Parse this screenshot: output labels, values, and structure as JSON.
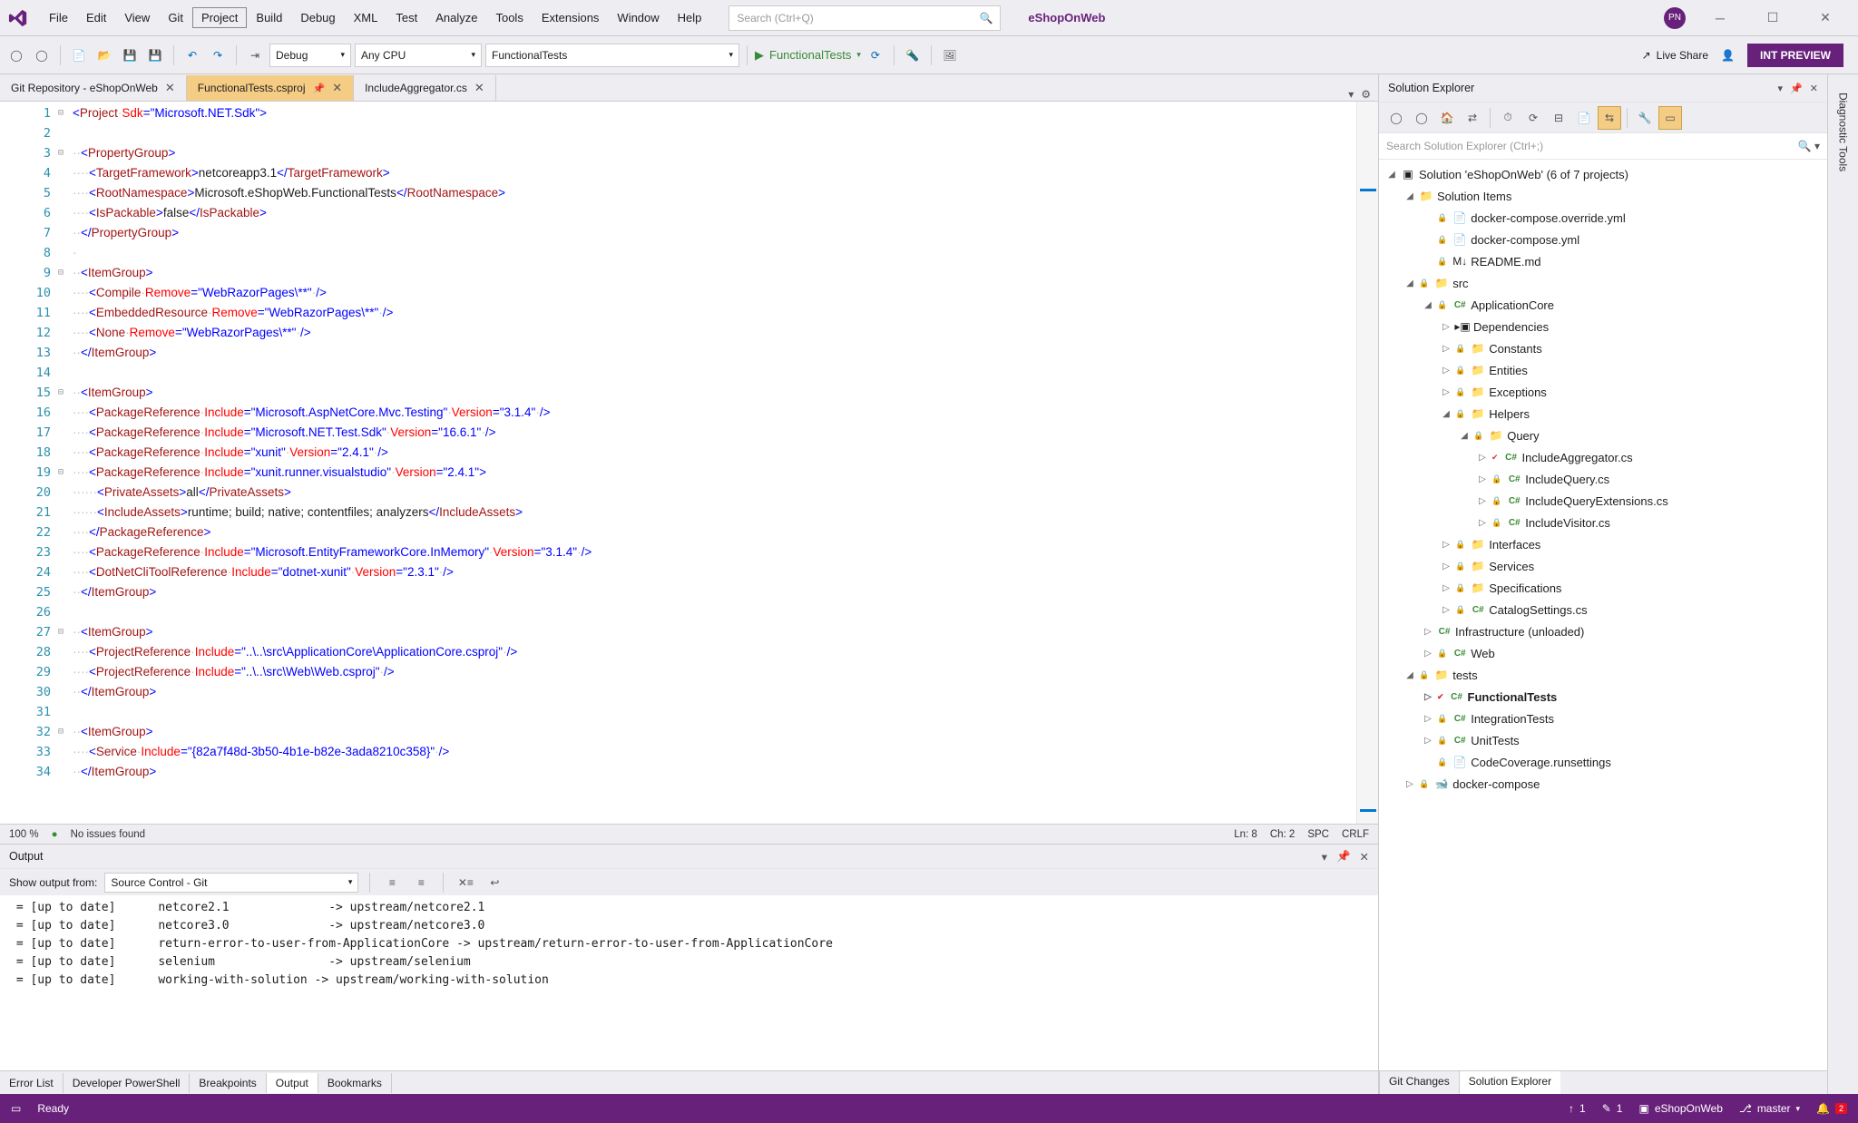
{
  "menubar": {
    "items": [
      "File",
      "Edit",
      "View",
      "Git",
      "Project",
      "Build",
      "Debug",
      "XML",
      "Test",
      "Analyze",
      "Tools",
      "Extensions",
      "Window",
      "Help"
    ],
    "boxedIndex": 4,
    "searchPlaceholder": "Search (Ctrl+Q)",
    "solutionName": "eShopOnWeb",
    "avatar": "PN"
  },
  "toolbar": {
    "config": "Debug",
    "platform": "Any CPU",
    "startupProject": "FunctionalTests",
    "startTarget": "FunctionalTests",
    "liveShare": "Live Share",
    "intPreview": "INT PREVIEW"
  },
  "tabs": {
    "items": [
      {
        "label": "Git Repository - eShopOnWeb",
        "active": false,
        "pinned": false
      },
      {
        "label": "FunctionalTests.csproj",
        "active": true,
        "pinned": true
      },
      {
        "label": "IncludeAggregator.cs",
        "active": false,
        "pinned": false
      }
    ]
  },
  "editor": {
    "lines": [
      {
        "n": 1,
        "fold": "⊟",
        "html": "<span class='c-blue'>&lt;</span><span class='c-brown'>Project</span><span class='c-dot'>·</span><span class='c-red'>Sdk</span><span class='c-blue'>=\"Microsoft.NET.Sdk\"&gt;</span>"
      },
      {
        "n": 2,
        "fold": "",
        "html": ""
      },
      {
        "n": 3,
        "fold": "⊟",
        "html": "<span class='c-dot'>··</span><span class='c-blue'>&lt;</span><span class='c-brown'>PropertyGroup</span><span class='c-blue'>&gt;</span>"
      },
      {
        "n": 4,
        "fold": "",
        "html": "<span class='c-dot'>····</span><span class='c-blue'>&lt;</span><span class='c-brown'>TargetFramework</span><span class='c-blue'>&gt;</span>netcoreapp3.1<span class='c-blue'>&lt;/</span><span class='c-brown'>TargetFramework</span><span class='c-blue'>&gt;</span>"
      },
      {
        "n": 5,
        "fold": "",
        "html": "<span class='c-dot'>····</span><span class='c-blue'>&lt;</span><span class='c-brown'>RootNamespace</span><span class='c-blue'>&gt;</span>Microsoft.eShopWeb.FunctionalTests<span class='c-blue'>&lt;/</span><span class='c-brown'>RootNamespace</span><span class='c-blue'>&gt;</span>"
      },
      {
        "n": 6,
        "fold": "",
        "html": "<span class='c-dot'>····</span><span class='c-blue'>&lt;</span><span class='c-brown'>IsPackable</span><span class='c-blue'>&gt;</span>false<span class='c-blue'>&lt;/</span><span class='c-brown'>IsPackable</span><span class='c-blue'>&gt;</span>"
      },
      {
        "n": 7,
        "fold": "",
        "html": "<span class='c-dot'>··</span><span class='c-blue'>&lt;/</span><span class='c-brown'>PropertyGroup</span><span class='c-blue'>&gt;</span>"
      },
      {
        "n": 8,
        "fold": "",
        "html": "<span class='c-dot'>·</span>"
      },
      {
        "n": 9,
        "fold": "⊟",
        "html": "<span class='c-dot'>··</span><span class='c-blue'>&lt;</span><span class='c-brown'>ItemGroup</span><span class='c-blue'>&gt;</span>"
      },
      {
        "n": 10,
        "fold": "",
        "html": "<span class='c-dot'>····</span><span class='c-blue'>&lt;</span><span class='c-brown'>Compile</span><span class='c-dot'>·</span><span class='c-red'>Remove</span><span class='c-blue'>=\"WebRazorPages\\**\"</span><span class='c-dot'>·</span><span class='c-blue'>/&gt;</span>"
      },
      {
        "n": 11,
        "fold": "",
        "html": "<span class='c-dot'>····</span><span class='c-blue'>&lt;</span><span class='c-brown'>EmbeddedResource</span><span class='c-dot'>·</span><span class='c-red'>Remove</span><span class='c-blue'>=\"WebRazorPages\\**\"</span><span class='c-dot'>·</span><span class='c-blue'>/&gt;</span>"
      },
      {
        "n": 12,
        "fold": "",
        "html": "<span class='c-dot'>····</span><span class='c-blue'>&lt;</span><span class='c-brown'>None</span><span class='c-dot'>·</span><span class='c-red'>Remove</span><span class='c-blue'>=\"WebRazorPages\\**\"</span><span class='c-dot'>·</span><span class='c-blue'>/&gt;</span>"
      },
      {
        "n": 13,
        "fold": "",
        "html": "<span class='c-dot'>··</span><span class='c-blue'>&lt;/</span><span class='c-brown'>ItemGroup</span><span class='c-blue'>&gt;</span>"
      },
      {
        "n": 14,
        "fold": "",
        "html": ""
      },
      {
        "n": 15,
        "fold": "⊟",
        "html": "<span class='c-dot'>··</span><span class='c-blue'>&lt;</span><span class='c-brown'>ItemGroup</span><span class='c-blue'>&gt;</span>"
      },
      {
        "n": 16,
        "fold": "",
        "html": "<span class='c-dot'>····</span><span class='c-blue'>&lt;</span><span class='c-brown'>PackageReference</span><span class='c-dot'>·</span><span class='c-red'>Include</span><span class='c-blue'>=\"Microsoft.AspNetCore.Mvc.Testing\"</span><span class='c-dot'>·</span><span class='c-red'>Version</span><span class='c-blue'>=\"3.1.4\"</span><span class='c-dot'>·</span><span class='c-blue'>/&gt;</span>"
      },
      {
        "n": 17,
        "fold": "",
        "html": "<span class='c-dot'>····</span><span class='c-blue'>&lt;</span><span class='c-brown'>PackageReference</span><span class='c-dot'>·</span><span class='c-red'>Include</span><span class='c-blue'>=\"Microsoft.NET.Test.Sdk\"</span><span class='c-dot'>·</span><span class='c-red'>Version</span><span class='c-blue'>=\"16.6.1\"</span><span class='c-dot'>·</span><span class='c-blue'>/&gt;</span>"
      },
      {
        "n": 18,
        "fold": "",
        "html": "<span class='c-dot'>····</span><span class='c-blue'>&lt;</span><span class='c-brown'>PackageReference</span><span class='c-dot'>·</span><span class='c-red'>Include</span><span class='c-blue'>=\"xunit\"</span><span class='c-dot'>·</span><span class='c-red'>Version</span><span class='c-blue'>=\"2.4.1\"</span><span class='c-dot'>·</span><span class='c-blue'>/&gt;</span>"
      },
      {
        "n": 19,
        "fold": "⊟",
        "html": "<span class='c-dot'>····</span><span class='c-blue'>&lt;</span><span class='c-brown'>PackageReference</span><span class='c-dot'>·</span><span class='c-red'>Include</span><span class='c-blue'>=\"xunit.runner.visualstudio\"</span><span class='c-dot'>·</span><span class='c-red'>Version</span><span class='c-blue'>=\"2.4.1\"&gt;</span>"
      },
      {
        "n": 20,
        "fold": "",
        "html": "<span class='c-dot'>······</span><span class='c-blue'>&lt;</span><span class='c-brown'>PrivateAssets</span><span class='c-blue'>&gt;</span>all<span class='c-blue'>&lt;/</span><span class='c-brown'>PrivateAssets</span><span class='c-blue'>&gt;</span>"
      },
      {
        "n": 21,
        "fold": "",
        "html": "<span class='c-dot'>······</span><span class='c-blue'>&lt;</span><span class='c-brown'>IncludeAssets</span><span class='c-blue'>&gt;</span>runtime; build; native; contentfiles; analyzers<span class='c-blue'>&lt;/</span><span class='c-brown'>IncludeAssets</span><span class='c-blue'>&gt;</span>"
      },
      {
        "n": 22,
        "fold": "",
        "html": "<span class='c-dot'>····</span><span class='c-blue'>&lt;/</span><span class='c-brown'>PackageReference</span><span class='c-blue'>&gt;</span>"
      },
      {
        "n": 23,
        "fold": "",
        "html": "<span class='c-dot'>····</span><span class='c-blue'>&lt;</span><span class='c-brown'>PackageReference</span><span class='c-dot'>·</span><span class='c-red'>Include</span><span class='c-blue'>=\"Microsoft.EntityFrameworkCore.InMemory\"</span><span class='c-dot'>·</span><span class='c-red'>Version</span><span class='c-blue'>=\"3.1.4\"</span><span class='c-dot'>·</span><span class='c-blue'>/&gt;</span>"
      },
      {
        "n": 24,
        "fold": "",
        "html": "<span class='c-dot'>····</span><span class='c-blue'>&lt;</span><span class='c-brown'>DotNetCliToolReference</span><span class='c-dot'>·</span><span class='c-red'>Include</span><span class='c-blue'>=\"dotnet-xunit\"</span><span class='c-dot'>·</span><span class='c-red'>Version</span><span class='c-blue'>=\"2.3.1\"</span><span class='c-dot'>·</span><span class='c-blue'>/&gt;</span>"
      },
      {
        "n": 25,
        "fold": "",
        "html": "<span class='c-dot'>··</span><span class='c-blue'>&lt;/</span><span class='c-brown'>ItemGroup</span><span class='c-blue'>&gt;</span>"
      },
      {
        "n": 26,
        "fold": "",
        "html": ""
      },
      {
        "n": 27,
        "fold": "⊟",
        "html": "<span class='c-dot'>··</span><span class='c-blue'>&lt;</span><span class='c-brown'>ItemGroup</span><span class='c-blue'>&gt;</span>"
      },
      {
        "n": 28,
        "fold": "",
        "html": "<span class='c-dot'>····</span><span class='c-blue'>&lt;</span><span class='c-brown'>ProjectReference</span><span class='c-dot'>·</span><span class='c-red'>Include</span><span class='c-blue'>=\"..\\..\\src\\ApplicationCore\\ApplicationCore.csproj\"</span><span class='c-dot'>·</span><span class='c-blue'>/&gt;</span>"
      },
      {
        "n": 29,
        "fold": "",
        "html": "<span class='c-dot'>····</span><span class='c-blue'>&lt;</span><span class='c-brown'>ProjectReference</span><span class='c-dot'>·</span><span class='c-red'>Include</span><span class='c-blue'>=\"..\\..\\src\\Web\\Web.csproj\"</span><span class='c-dot'>·</span><span class='c-blue'>/&gt;</span>"
      },
      {
        "n": 30,
        "fold": "",
        "html": "<span class='c-dot'>··</span><span class='c-blue'>&lt;/</span><span class='c-brown'>ItemGroup</span><span class='c-blue'>&gt;</span>"
      },
      {
        "n": 31,
        "fold": "",
        "html": ""
      },
      {
        "n": 32,
        "fold": "⊟",
        "html": "<span class='c-dot'>··</span><span class='c-blue'>&lt;</span><span class='c-brown'>ItemGroup</span><span class='c-blue'>&gt;</span>"
      },
      {
        "n": 33,
        "fold": "",
        "html": "<span class='c-dot'>····</span><span class='c-blue'>&lt;</span><span class='c-brown'>Service</span><span class='c-dot'>·</span><span class='c-red'>Include</span><span class='c-blue'>=\"{82a7f48d-3b50-4b1e-b82e-3ada8210c358}\"</span><span class='c-dot'>·</span><span class='c-blue'>/&gt;</span>"
      },
      {
        "n": 34,
        "fold": "",
        "html": "<span class='c-dot'>··</span><span class='c-blue'>&lt;/</span><span class='c-brown'>ItemGroup</span><span class='c-blue'>&gt;</span>"
      }
    ]
  },
  "editorStatus": {
    "zoom": "100 %",
    "issues": "No issues found",
    "ln": "Ln: 8",
    "ch": "Ch: 2",
    "spc": "SPC",
    "crlf": "CRLF"
  },
  "output": {
    "title": "Output",
    "fromLabel": "Show output from:",
    "source": "Source Control - Git",
    "lines": [
      " = [up to date]      netcore2.1              -> upstream/netcore2.1",
      " = [up to date]      netcore3.0              -> upstream/netcore3.0",
      " = [up to date]      return-error-to-user-from-ApplicationCore -> upstream/return-error-to-user-from-ApplicationCore",
      " = [up to date]      selenium                -> upstream/selenium",
      " = [up to date]      working-with-solution -> upstream/working-with-solution"
    ]
  },
  "bottomTabs": [
    "Error List",
    "Developer PowerShell",
    "Breakpoints",
    "Output",
    "Bookmarks"
  ],
  "bottomActive": 3,
  "solexp": {
    "title": "Solution Explorer",
    "searchPlaceholder": "Search Solution Explorer (Ctrl+;)",
    "solutionLabel": "Solution 'eShopOnWeb' (6 of 7 projects)",
    "tree": [
      {
        "depth": 0,
        "tw": "◢",
        "icon": "sol",
        "label": "Solution 'eShopOnWeb' (6 of 7 projects)"
      },
      {
        "depth": 1,
        "tw": "◢",
        "icon": "folder",
        "label": "Solution Items"
      },
      {
        "depth": 2,
        "tw": "",
        "icon": "yaml",
        "lock": true,
        "label": "docker-compose.override.yml"
      },
      {
        "depth": 2,
        "tw": "",
        "icon": "yaml",
        "lock": true,
        "label": "docker-compose.yml"
      },
      {
        "depth": 2,
        "tw": "",
        "icon": "md",
        "lock": true,
        "label": "README.md"
      },
      {
        "depth": 1,
        "tw": "◢",
        "icon": "folder",
        "lock": true,
        "label": "src"
      },
      {
        "depth": 2,
        "tw": "◢",
        "icon": "csproj",
        "lock": true,
        "label": "ApplicationCore"
      },
      {
        "depth": 3,
        "tw": "▷",
        "icon": "deps",
        "label": "Dependencies"
      },
      {
        "depth": 3,
        "tw": "▷",
        "icon": "folder",
        "lock": true,
        "label": "Constants"
      },
      {
        "depth": 3,
        "tw": "▷",
        "icon": "folder",
        "lock": true,
        "label": "Entities"
      },
      {
        "depth": 3,
        "tw": "▷",
        "icon": "folder",
        "lock": true,
        "label": "Exceptions"
      },
      {
        "depth": 3,
        "tw": "◢",
        "icon": "folder",
        "lock": true,
        "label": "Helpers"
      },
      {
        "depth": 4,
        "tw": "◢",
        "icon": "folder",
        "lock": true,
        "label": "Query"
      },
      {
        "depth": 5,
        "tw": "▷",
        "icon": "cs",
        "check": true,
        "label": "IncludeAggregator.cs"
      },
      {
        "depth": 5,
        "tw": "▷",
        "icon": "cs",
        "lock": true,
        "label": "IncludeQuery.cs"
      },
      {
        "depth": 5,
        "tw": "▷",
        "icon": "cs",
        "lock": true,
        "label": "IncludeQueryExtensions.cs"
      },
      {
        "depth": 5,
        "tw": "▷",
        "icon": "cs",
        "lock": true,
        "label": "IncludeVisitor.cs"
      },
      {
        "depth": 3,
        "tw": "▷",
        "icon": "folder",
        "lock": true,
        "label": "Interfaces"
      },
      {
        "depth": 3,
        "tw": "▷",
        "icon": "folder",
        "lock": true,
        "label": "Services"
      },
      {
        "depth": 3,
        "tw": "▷",
        "icon": "folder",
        "lock": true,
        "label": "Specifications"
      },
      {
        "depth": 3,
        "tw": "▷",
        "icon": "cs",
        "lock": true,
        "label": "CatalogSettings.cs"
      },
      {
        "depth": 2,
        "tw": "▷",
        "icon": "csproj",
        "label": "Infrastructure (unloaded)"
      },
      {
        "depth": 2,
        "tw": "▷",
        "icon": "csproj",
        "lock": true,
        "label": "Web"
      },
      {
        "depth": 1,
        "tw": "◢",
        "icon": "folder",
        "lock": true,
        "label": "tests"
      },
      {
        "depth": 2,
        "tw": "▷",
        "icon": "csproj",
        "check": true,
        "bold": true,
        "label": "FunctionalTests"
      },
      {
        "depth": 2,
        "tw": "▷",
        "icon": "csproj",
        "lock": true,
        "label": "IntegrationTests"
      },
      {
        "depth": 2,
        "tw": "▷",
        "icon": "csproj",
        "lock": true,
        "label": "UnitTests"
      },
      {
        "depth": 2,
        "tw": "",
        "icon": "file",
        "lock": true,
        "label": "CodeCoverage.runsettings"
      },
      {
        "depth": 1,
        "tw": "▷",
        "icon": "docker",
        "lock": true,
        "label": "docker-compose"
      }
    ],
    "bottomTabs": [
      "Git Changes",
      "Solution Explorer"
    ],
    "bottomActive": 1
  },
  "sideTab": "Diagnostic Tools",
  "statusbar": {
    "ready": "Ready",
    "up": "1",
    "edit": "1",
    "repo": "eShopOnWeb",
    "branch": "master",
    "bell": "2"
  }
}
